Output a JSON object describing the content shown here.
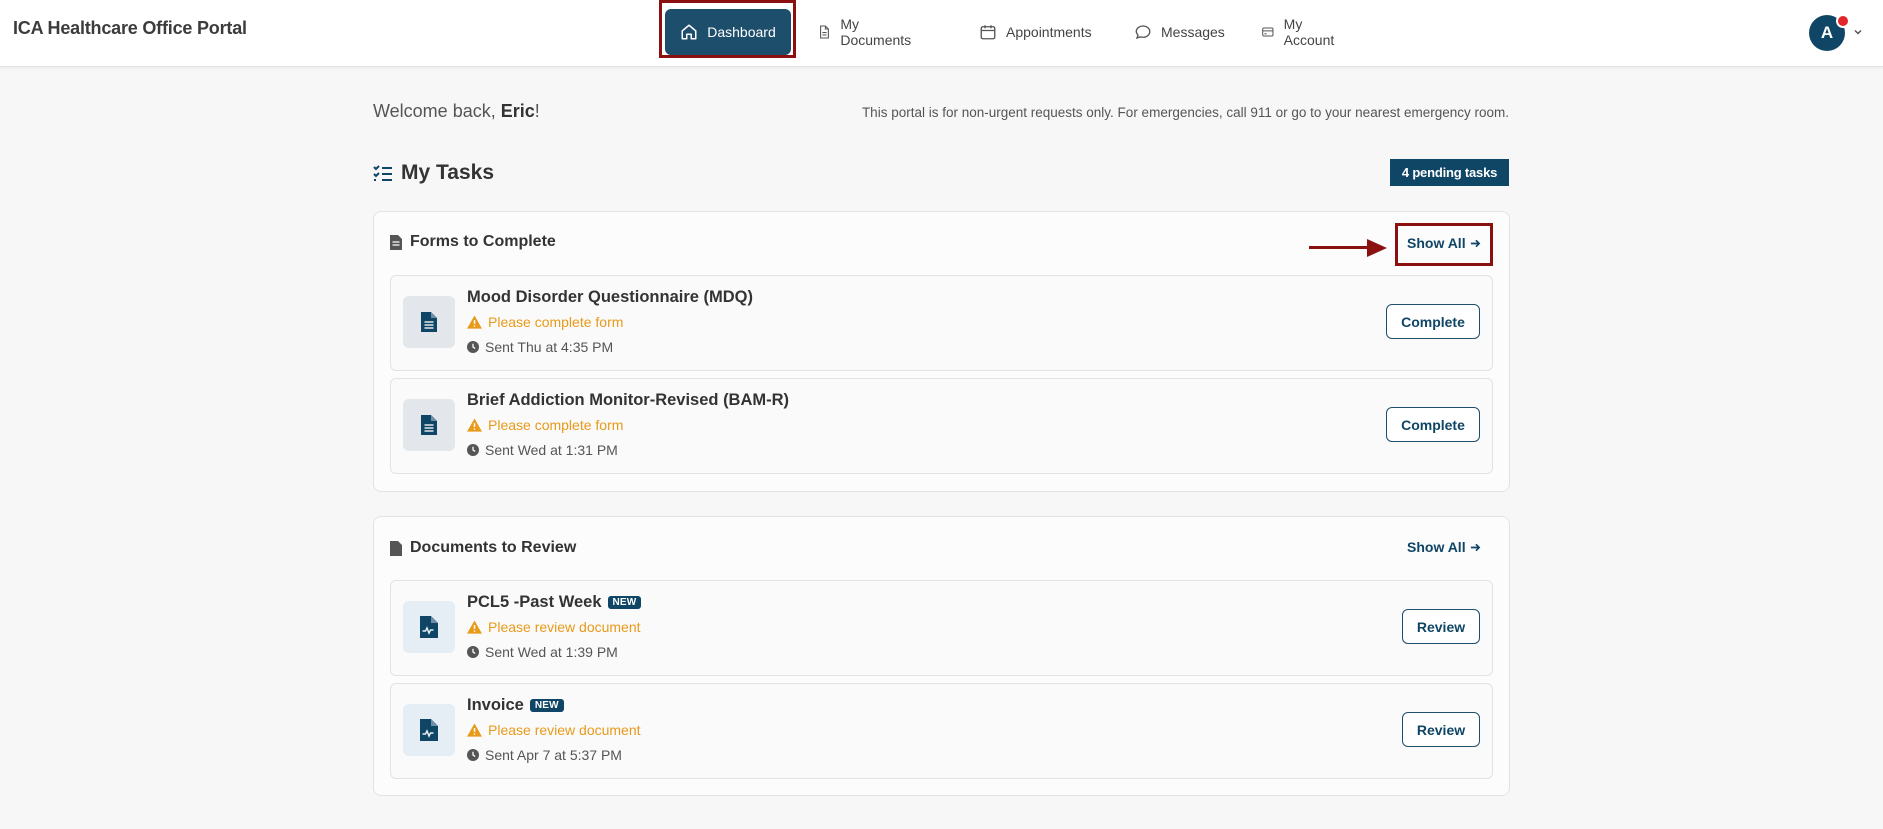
{
  "app": {
    "title": "ICA Healthcare Office Portal"
  },
  "nav": {
    "items": [
      {
        "label": "Dashboard",
        "icon": "home-icon",
        "active": true
      },
      {
        "label": "My Documents",
        "icon": "document-icon"
      },
      {
        "label": "Appointments",
        "icon": "calendar-icon"
      },
      {
        "label": "Messages",
        "icon": "chat-icon"
      },
      {
        "label": "My Account",
        "icon": "card-icon"
      }
    ]
  },
  "user": {
    "initial": "A",
    "has_notification": true
  },
  "welcome": {
    "prefix": "Welcome back, ",
    "name": "Eric",
    "suffix": "!"
  },
  "notice": "This portal is for non-urgent requests only. For emergencies, call 911 or go to your nearest emergency room.",
  "tasks": {
    "title": "My Tasks",
    "pending_badge": "4 pending tasks"
  },
  "forms": {
    "title": "Forms to Complete",
    "show_all": "Show All",
    "items": [
      {
        "title": "Mood Disorder Questionnaire (MDQ)",
        "status": "Please complete form",
        "sent": "Sent Thu at 4:35 PM",
        "button": "Complete"
      },
      {
        "title": "Brief Addiction Monitor-Revised (BAM-R)",
        "status": "Please complete form",
        "sent": "Sent Wed at 1:31 PM",
        "button": "Complete"
      }
    ]
  },
  "documents": {
    "title": "Documents to Review",
    "show_all": "Show All",
    "items": [
      {
        "title": "PCL5 -Past Week",
        "badge": "NEW",
        "status": "Please review document",
        "sent": "Sent Wed at 1:39 PM",
        "button": "Review"
      },
      {
        "title": "Invoice",
        "badge": "NEW",
        "status": "Please review document",
        "sent": "Sent Apr 7 at 5:37 PM",
        "button": "Review"
      }
    ]
  },
  "colors": {
    "primary": "#0f4565",
    "warning": "#e89a19",
    "annotation": "#8b1111",
    "notification": "#e0262a"
  }
}
